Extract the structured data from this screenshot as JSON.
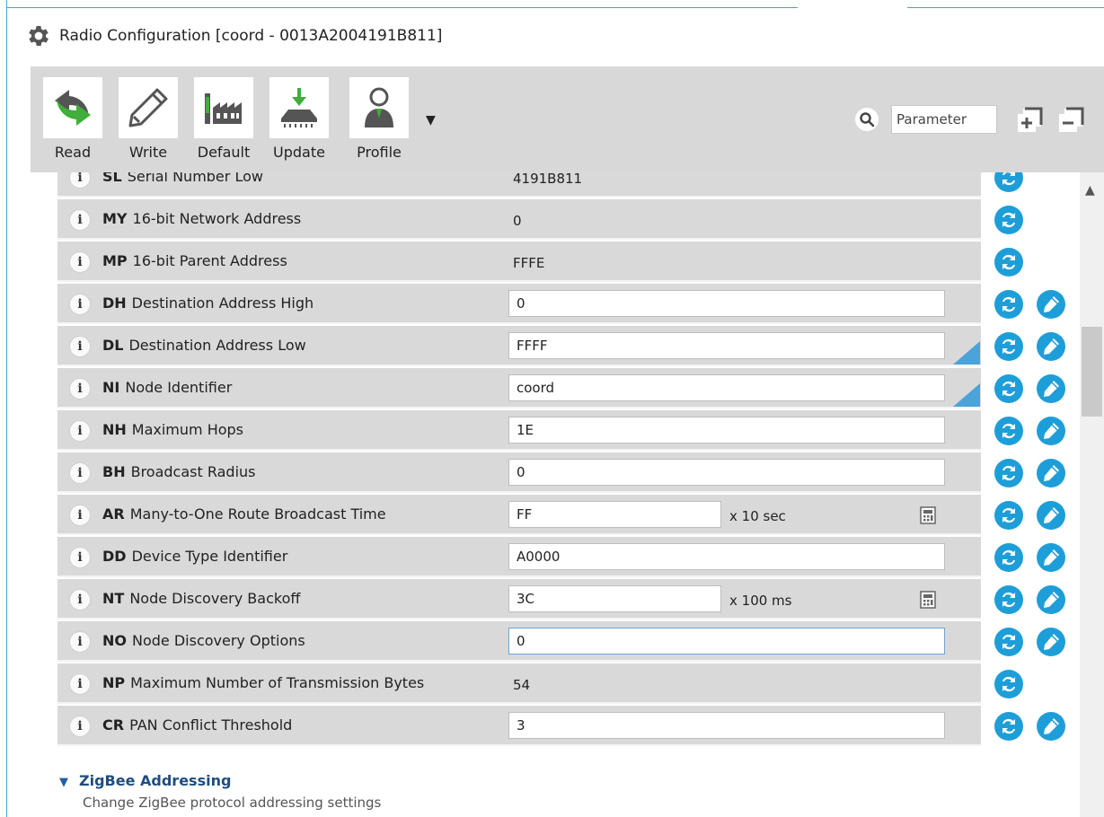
{
  "window": {
    "title": "Radio Configuration [coord - 0013A2004191B811]"
  },
  "colors": {
    "accent": "#1e9ed8",
    "toolbar_bg": "#d8d8d8",
    "row_bg": "#d9d9d9",
    "section_title": "#1f4d80"
  },
  "toolbar": {
    "read_label": "Read",
    "write_label": "Write",
    "default_label": "Default",
    "update_label": "Update",
    "profile_label": "Profile",
    "search_placeholder": "Parameter"
  },
  "rows": [
    {
      "code": "SL",
      "label": "Serial Number Low",
      "value": "4191B811",
      "editable": false
    },
    {
      "code": "MY",
      "label": "16-bit Network Address",
      "value": "0",
      "editable": false
    },
    {
      "code": "MP",
      "label": "16-bit Parent Address",
      "value": "FFFE",
      "editable": false
    },
    {
      "code": "DH",
      "label": "Destination Address High",
      "value": "0",
      "editable": true
    },
    {
      "code": "DL",
      "label": "Destination Address Low",
      "value": "FFFF",
      "editable": true
    },
    {
      "code": "NI",
      "label": "Node Identifier",
      "value": "coord",
      "editable": true
    },
    {
      "code": "NH",
      "label": "Maximum Hops",
      "value": "1E",
      "editable": true
    },
    {
      "code": "BH",
      "label": "Broadcast Radius",
      "value": "0",
      "editable": true
    },
    {
      "code": "AR",
      "label": "Many-to-One Route Broadcast Time",
      "value": "FF",
      "unit": "x 10 sec",
      "editable": true
    },
    {
      "code": "DD",
      "label": "Device Type Identifier",
      "value": "A0000",
      "editable": true
    },
    {
      "code": "NT",
      "label": "Node Discovery Backoff",
      "value": "3C",
      "unit": "x 100 ms",
      "editable": true
    },
    {
      "code": "NO",
      "label": "Node Discovery Options",
      "value": "0",
      "editable": true
    },
    {
      "code": "NP",
      "label": "Maximum Number of Transmission Bytes",
      "value": "54",
      "editable": false
    },
    {
      "code": "CR",
      "label": "PAN Conflict Threshold",
      "value": "3",
      "editable": true
    }
  ],
  "section": {
    "title": "ZigBee Addressing",
    "description": "Change ZigBee protocol addressing settings"
  }
}
